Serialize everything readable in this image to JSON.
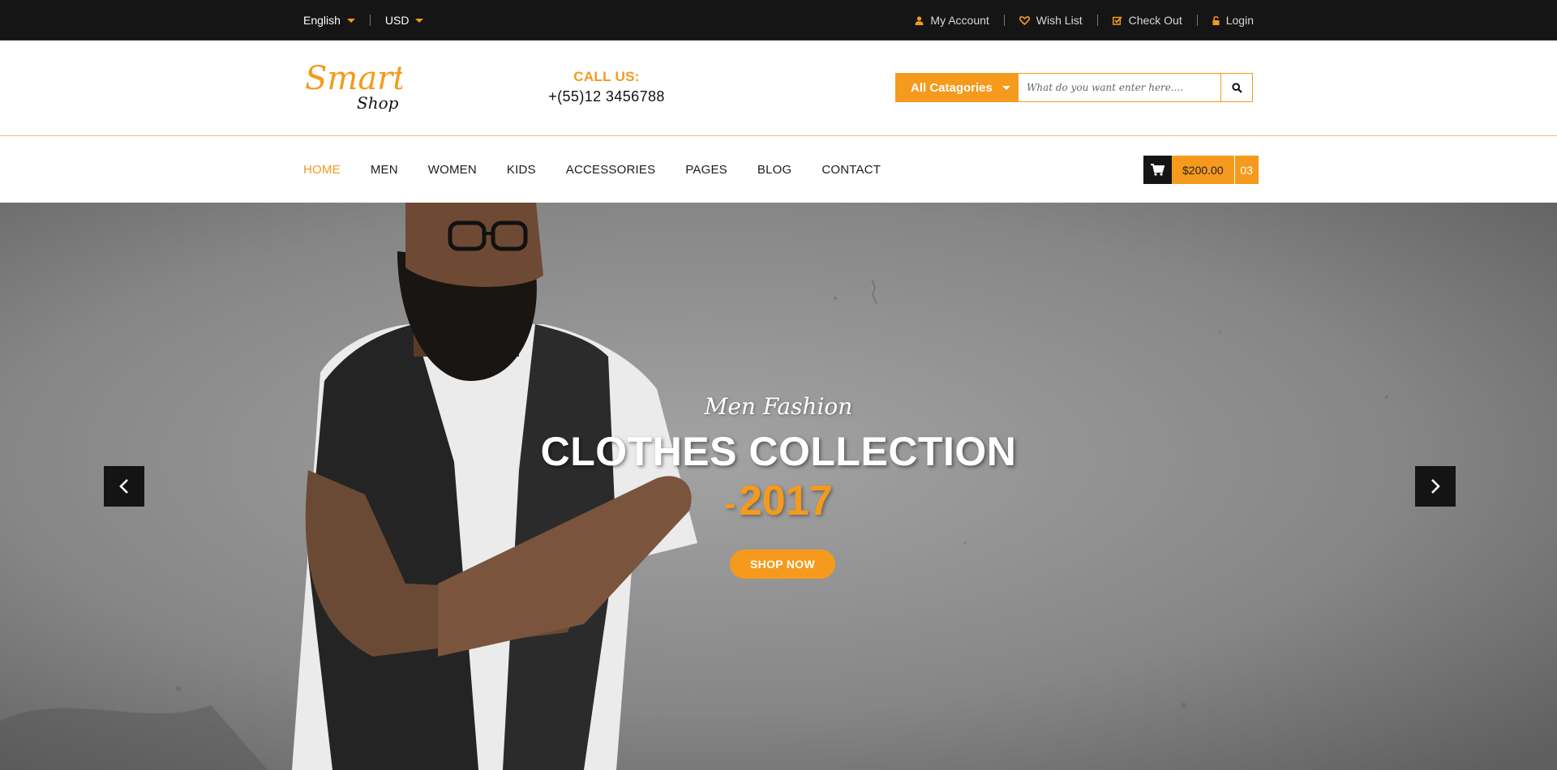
{
  "topbar": {
    "language": "English",
    "currency": "USD",
    "links": [
      {
        "label": "My Account",
        "icon": "user-icon"
      },
      {
        "label": "Wish List",
        "icon": "heart-icon"
      },
      {
        "label": "Check Out",
        "icon": "check-square-icon"
      },
      {
        "label": "Login",
        "icon": "lock-icon"
      }
    ]
  },
  "header": {
    "logo": {
      "word1": "Smart",
      "word2": "Shop"
    },
    "call_label": "CALL US:",
    "call_number": "+(55)12 3456788",
    "search": {
      "category": "All Catagories",
      "placeholder": "What do you want enter here...."
    }
  },
  "nav": {
    "items": [
      "HOME",
      "MEN",
      "WOMEN",
      "KIDS",
      "ACCESSORIES",
      "PAGES",
      "BLOG",
      "CONTACT"
    ],
    "active": "HOME"
  },
  "cart": {
    "amount": "$200.00",
    "count": "03"
  },
  "hero": {
    "subtitle": "Men Fashion",
    "title": "CLOTHES COLLECTION",
    "year_prefix": "-",
    "year": "2017",
    "button": "SHOP NOW"
  },
  "colors": {
    "accent": "#f59a1c",
    "dark": "#151515"
  }
}
